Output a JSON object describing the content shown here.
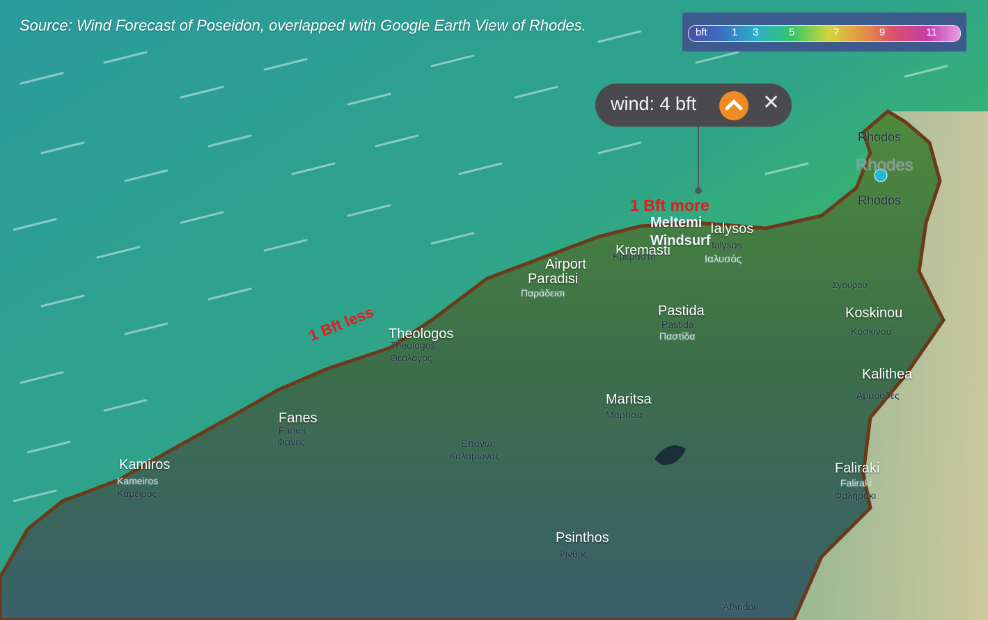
{
  "source_text": "Source: Wind Forecast of Poseidon, overlapped with Google Earth View of Rhodes.",
  "legend": {
    "unit": "bft",
    "ticks": [
      "1",
      "3",
      "5",
      "7",
      "9",
      "11"
    ]
  },
  "tooltip": {
    "text": "wind: 4 bft",
    "icons": [
      "chevron-up-icon",
      "close-icon"
    ]
  },
  "annotations": {
    "more": "1 Bft more",
    "less": "1 Bft less",
    "spot_line1": "Meltemi",
    "spot_line2": "Windsurf"
  },
  "places": [
    {
      "name": "Rhodos",
      "latin": "Rhodes",
      "greek": "Rhodos"
    },
    {
      "name": "Ialysos",
      "latin": "Ialysos",
      "greek": "Ιαλυσός"
    },
    {
      "name": "Kremasti",
      "greek": "Κρεμαστή"
    },
    {
      "name": "Airport",
      "name2": "Paradisi",
      "greek": "Παράδεισι"
    },
    {
      "name": "Theologos",
      "latin": "Theologos",
      "greek": "Θεολογος"
    },
    {
      "name": "Pastida",
      "latin": "Pastida",
      "greek": "Παστίδα"
    },
    {
      "name": "Koskinou",
      "greek": "Κοσκινού"
    },
    {
      "name": "Kalithea",
      "greek": "Αμμουδες"
    },
    {
      "name": "Maritsa",
      "greek": "Μαρίτσα"
    },
    {
      "name": "Fanes",
      "latin": "Fanes",
      "greek": "Φανες"
    },
    {
      "name": "Kamiros",
      "latin": "Kameiros",
      "greek": "Κάμειρος"
    },
    {
      "name": "Faliraki",
      "latin": "Faliraki",
      "greek": "Φαληράκι"
    },
    {
      "name": "Psinthos",
      "greek": "Ψινθος"
    }
  ],
  "minor_labels": {
    "kalamonas_1": "Επανω",
    "kalamonas_2": "Καλαμωνας",
    "sgourou": "Σγουρου",
    "afandou": "Afandou"
  }
}
